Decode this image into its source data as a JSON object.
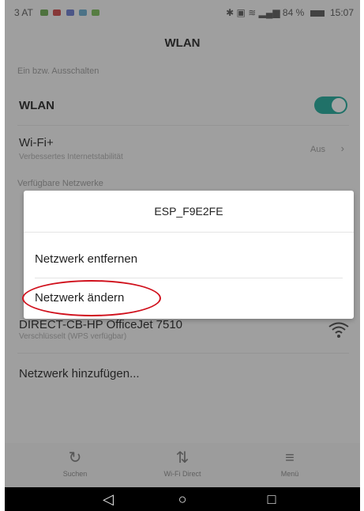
{
  "status_bar": {
    "carrier": "3 AT",
    "battery_percent": "84 %",
    "time": "15:07"
  },
  "app_bar": {
    "title": "WLAN"
  },
  "settings": {
    "section_header": "Ein bzw. Ausschalten",
    "wlan_label": "WLAN",
    "wlan_enabled": true,
    "wifi_plus_label": "Wi-Fi+",
    "wifi_plus_sub": "Verbessertes Internetstabilität",
    "wifi_plus_value": "Aus",
    "available_networks_header": "Verfügbare Netzwerke",
    "network_direct_name": "DIRECT-CB-HP OfficeJet 7510",
    "network_direct_sub": "Verschlüsselt (WPS verfügbar)",
    "add_network": "Netzwerk hinzufügen..."
  },
  "dialog": {
    "title": "ESP_F9E2FE",
    "items": [
      "Netzwerk entfernen",
      "Netzwerk ändern"
    ],
    "highlight_color": "#d0101c"
  },
  "bottom_bar": {
    "items": [
      {
        "icon": "search-refresh-icon",
        "label": "Suchen"
      },
      {
        "icon": "wifi-direct-icon",
        "label": "Wi-Fi Direct"
      },
      {
        "icon": "menu-icon",
        "label": "Menü"
      }
    ]
  },
  "colors": {
    "accent": "#1aa596",
    "background": "#f4f4f4"
  }
}
